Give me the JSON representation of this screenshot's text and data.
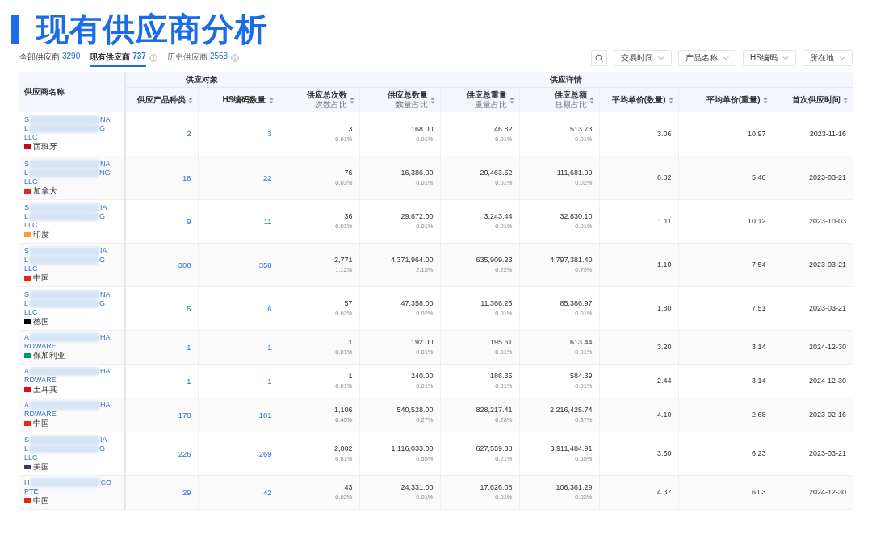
{
  "title": "现有供应商分析",
  "tabs": [
    {
      "label": "全部供应商",
      "count": "3290",
      "selected": false,
      "info": false
    },
    {
      "label": "现有供应商",
      "count": "737",
      "selected": true,
      "info": true
    },
    {
      "label": "历史供应商",
      "count": "2553",
      "selected": false,
      "info": true
    }
  ],
  "filters": [
    "交易时间",
    "产品名称",
    "HS编码",
    "所在地"
  ],
  "table": {
    "name_header": "供应商名称",
    "groups": [
      {
        "label": "供应对象",
        "columns": [
          {
            "label": "供应产品种类"
          },
          {
            "label": "HS编码数量"
          }
        ]
      },
      {
        "label": "供应详情",
        "columns": [
          {
            "label": "供应总次数",
            "sub": "次数占比"
          },
          {
            "label": "供应总数量",
            "sub": "数量占比"
          },
          {
            "label": "供应总重量",
            "sub": "重量占比"
          },
          {
            "label": "供应总额",
            "sub": "总额占比"
          },
          {
            "label": "平均单价(数量)"
          },
          {
            "label": "平均单价(重量)"
          },
          {
            "label": "首次供应时间"
          }
        ]
      }
    ],
    "rows": [
      {
        "name": [
          {
            "start": "S",
            "end": "NA"
          },
          {
            "start": "L",
            "end": "G"
          },
          {
            "start": "LLC"
          }
        ],
        "country": {
          "name": "西班牙",
          "color": "#c60b1e"
        },
        "cells": [
          {
            "value": "2"
          },
          {
            "value": "3"
          },
          {
            "value": "3",
            "share": "0.01%"
          },
          {
            "value": "168.00",
            "share": "0.01%"
          },
          {
            "value": "46.82",
            "share": "0.01%"
          },
          {
            "value": "513.73",
            "share": "0.01%"
          },
          {
            "value": "3.06"
          },
          {
            "value": "10.97"
          },
          {
            "value": "2023-11-16"
          }
        ]
      },
      {
        "name": [
          {
            "start": "S",
            "end": "NA"
          },
          {
            "start": "L",
            "end": "NG"
          },
          {
            "start": "LLC"
          }
        ],
        "country": {
          "name": "加拿大",
          "color": "#d52b1e"
        },
        "cells": [
          {
            "value": "18"
          },
          {
            "value": "22"
          },
          {
            "value": "76",
            "share": "0.03%"
          },
          {
            "value": "16,386.00",
            "share": "0.01%"
          },
          {
            "value": "20,463.52",
            "share": "0.01%"
          },
          {
            "value": "111,681.09",
            "share": "0.02%"
          },
          {
            "value": "6.82"
          },
          {
            "value": "5.46"
          },
          {
            "value": "2023-03-21"
          }
        ]
      },
      {
        "name": [
          {
            "start": "S",
            "end": "IA"
          },
          {
            "start": "L",
            "end": "G"
          },
          {
            "start": "LLC"
          }
        ],
        "country": {
          "name": "印度",
          "color": "#ff9933"
        },
        "cells": [
          {
            "value": "9"
          },
          {
            "value": "11"
          },
          {
            "value": "36",
            "share": "0.01%"
          },
          {
            "value": "29,672.00",
            "share": "0.01%"
          },
          {
            "value": "3,243.44",
            "share": "0.01%"
          },
          {
            "value": "32,830.10",
            "share": "0.01%"
          },
          {
            "value": "1.11"
          },
          {
            "value": "10.12"
          },
          {
            "value": "2023-10-03"
          }
        ]
      },
      {
        "name": [
          {
            "start": "S",
            "end": "IA"
          },
          {
            "start": "L",
            "end": "G"
          },
          {
            "start": "LLC"
          }
        ],
        "country": {
          "name": "中国",
          "color": "#de2910"
        },
        "cells": [
          {
            "value": "308"
          },
          {
            "value": "358"
          },
          {
            "value": "2,771",
            "share": "1.12%"
          },
          {
            "value": "4,371,964.00",
            "share": "2.15%"
          },
          {
            "value": "635,909.23",
            "share": "0.22%"
          },
          {
            "value": "4,797,381.40",
            "share": "0.79%"
          },
          {
            "value": "1.10"
          },
          {
            "value": "7.54"
          },
          {
            "value": "2023-03-21"
          }
        ]
      },
      {
        "name": [
          {
            "start": "S",
            "end": "NA"
          },
          {
            "start": "L",
            "end": "G"
          },
          {
            "start": "LLC"
          }
        ],
        "country": {
          "name": "德国",
          "color": "#000000"
        },
        "cells": [
          {
            "value": "5"
          },
          {
            "value": "6"
          },
          {
            "value": "57",
            "share": "0.02%"
          },
          {
            "value": "47,358.00",
            "share": "0.02%"
          },
          {
            "value": "11,366.26",
            "share": "0.01%"
          },
          {
            "value": "85,386.97",
            "share": "0.01%"
          },
          {
            "value": "1.80"
          },
          {
            "value": "7.51"
          },
          {
            "value": "2023-03-21"
          }
        ]
      },
      {
        "name": [
          {
            "start": "A",
            "end": "HA"
          },
          {
            "start": "RDWARE"
          }
        ],
        "country": {
          "name": "保加利亚",
          "color": "#00966e"
        },
        "cells": [
          {
            "value": "1"
          },
          {
            "value": "1"
          },
          {
            "value": "1",
            "share": "0.01%"
          },
          {
            "value": "192.00",
            "share": "0.01%"
          },
          {
            "value": "195.61",
            "share": "0.01%"
          },
          {
            "value": "613.44",
            "share": "0.01%"
          },
          {
            "value": "3.20"
          },
          {
            "value": "3.14"
          },
          {
            "value": "2024-12-30"
          }
        ]
      },
      {
        "name": [
          {
            "start": "A",
            "end": "HA"
          },
          {
            "start": "RDWARE"
          }
        ],
        "country": {
          "name": "土耳其",
          "color": "#e30a17"
        },
        "cells": [
          {
            "value": "1"
          },
          {
            "value": "1"
          },
          {
            "value": "1",
            "share": "0.01%"
          },
          {
            "value": "240.00",
            "share": "0.01%"
          },
          {
            "value": "186.35",
            "share": "0.01%"
          },
          {
            "value": "584.39",
            "share": "0.01%"
          },
          {
            "value": "2.44"
          },
          {
            "value": "3.14"
          },
          {
            "value": "2024-12-30"
          }
        ]
      },
      {
        "name": [
          {
            "start": "A",
            "end": "HA"
          },
          {
            "start": "RDWARE"
          }
        ],
        "country": {
          "name": "中国",
          "color": "#de2910"
        },
        "cells": [
          {
            "value": "178"
          },
          {
            "value": "181"
          },
          {
            "value": "1,106",
            "share": "0.45%"
          },
          {
            "value": "540,528.00",
            "share": "0.27%"
          },
          {
            "value": "828,217.41",
            "share": "0.28%"
          },
          {
            "value": "2,216,425.74",
            "share": "0.37%"
          },
          {
            "value": "4.10"
          },
          {
            "value": "2.68"
          },
          {
            "value": "2023-02-16"
          }
        ]
      },
      {
        "name": [
          {
            "start": "S",
            "end": "IA"
          },
          {
            "start": "L",
            "end": "G"
          },
          {
            "start": "LLC"
          }
        ],
        "country": {
          "name": "美国",
          "color": "#3c3b6e"
        },
        "cells": [
          {
            "value": "226"
          },
          {
            "value": "269"
          },
          {
            "value": "2,002",
            "share": "0.81%"
          },
          {
            "value": "1,116,033.00",
            "share": "0.55%"
          },
          {
            "value": "627,559.38",
            "share": "0.21%"
          },
          {
            "value": "3,911,484.91",
            "share": "0.65%"
          },
          {
            "value": "3.50"
          },
          {
            "value": "6.23"
          },
          {
            "value": "2023-03-21"
          }
        ]
      },
      {
        "name": [
          {
            "start": "H",
            "end": "CO"
          },
          {
            "start": "PTE"
          }
        ],
        "country": {
          "name": "中国",
          "color": "#de2910"
        },
        "cells": [
          {
            "value": "29"
          },
          {
            "value": "42"
          },
          {
            "value": "43",
            "share": "0.02%"
          },
          {
            "value": "24,331.00",
            "share": "0.01%"
          },
          {
            "value": "17,626.08",
            "share": "0.01%"
          },
          {
            "value": "106,361.29",
            "share": "0.02%"
          },
          {
            "value": "4.37"
          },
          {
            "value": "6.03"
          },
          {
            "value": "2024-12-30"
          }
        ]
      }
    ]
  }
}
